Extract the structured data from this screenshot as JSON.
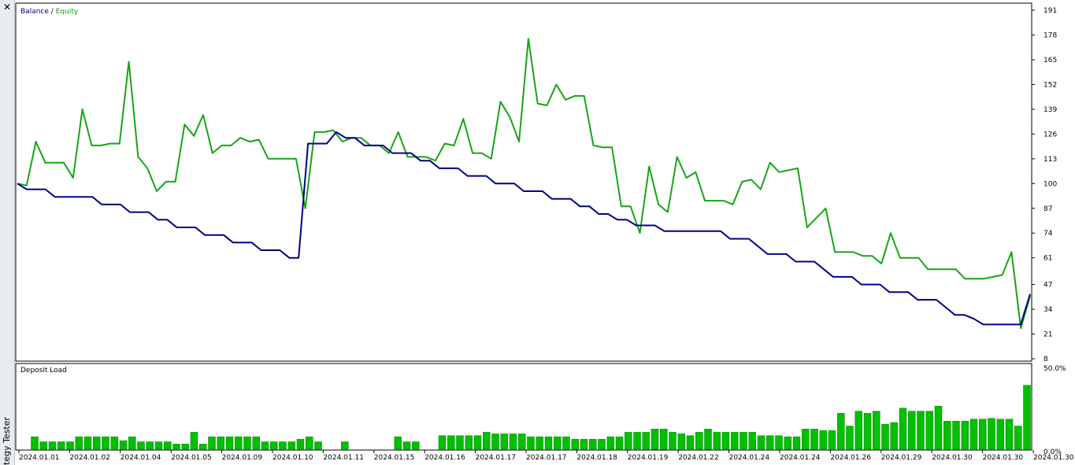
{
  "window": {
    "close_glyph": "✕",
    "side_label": "tegy Tester"
  },
  "colors": {
    "balance": "#00008b",
    "equity": "#16a516",
    "bars": "#00c000",
    "bar_border": "#008000",
    "frame": "#000000",
    "text": "#000000"
  },
  "chart_data": [
    {
      "type": "line",
      "title": "",
      "legend": [
        {
          "name": "Balance",
          "color": "#00008b"
        },
        {
          "name": "Equity",
          "color": "#16a516"
        }
      ],
      "legend_separator": " / ",
      "ylim": [
        8,
        191
      ],
      "yticks": [
        191,
        178,
        165,
        152,
        139,
        126,
        113,
        100,
        87,
        74,
        61,
        47,
        34,
        21,
        8
      ],
      "x_count": 103,
      "series": [
        {
          "name": "Balance",
          "values": [
            100,
            97,
            97,
            97,
            93,
            93,
            93,
            93,
            93,
            89,
            89,
            89,
            85,
            85,
            85,
            81,
            81,
            77,
            77,
            77,
            73,
            73,
            73,
            69,
            69,
            69,
            65,
            65,
            65,
            61,
            61,
            121,
            121,
            121,
            127,
            124,
            124,
            120,
            120,
            120,
            116,
            116,
            116,
            112,
            112,
            108,
            108,
            108,
            104,
            104,
            104,
            100,
            100,
            100,
            96,
            96,
            96,
            92,
            92,
            92,
            88,
            88,
            84,
            84,
            81,
            81,
            78,
            78,
            78,
            75,
            75,
            75,
            75,
            75,
            75,
            75,
            71,
            71,
            71,
            67,
            63,
            63,
            63,
            59,
            59,
            59,
            55,
            51,
            51,
            51,
            47,
            47,
            47,
            43,
            43,
            43,
            39,
            39,
            39,
            35,
            31,
            31,
            29,
            26,
            26,
            26,
            26,
            26,
            42
          ]
        },
        {
          "name": "Equity",
          "values": [
            100,
            99,
            122,
            111,
            111,
            111,
            103,
            139,
            120,
            120,
            121,
            121,
            164,
            114,
            108,
            96,
            101,
            101,
            131,
            125,
            136,
            116,
            120,
            120,
            124,
            122,
            123,
            113,
            113,
            113,
            113,
            87,
            127,
            127,
            128,
            122,
            124,
            124,
            120,
            120,
            116,
            127,
            114,
            114,
            114,
            112,
            121,
            120,
            134,
            116,
            116,
            113,
            143,
            135,
            122,
            176,
            142,
            141,
            152,
            144,
            146,
            146,
            120,
            119,
            119,
            88,
            88,
            74,
            109,
            89,
            85,
            114,
            103,
            106,
            91,
            91,
            91,
            89,
            101,
            102,
            97,
            111,
            106,
            107,
            108,
            77,
            82,
            87,
            64,
            64,
            64,
            62,
            62,
            58,
            74,
            61,
            61,
            61,
            55,
            55,
            55,
            55,
            50,
            50,
            50,
            51,
            52,
            64,
            24,
            41
          ]
        }
      ]
    },
    {
      "type": "bar",
      "title": "Deposit Load",
      "ylim": [
        0,
        50
      ],
      "ytick_labels": [
        "50.0%",
        "0.0%"
      ],
      "values": [
        7.7,
        4.6,
        4.6,
        4.6,
        4.6,
        7.7,
        7.7,
        7.7,
        7.7,
        7.7,
        5.3,
        7.7,
        4.6,
        4.6,
        4.6,
        4.6,
        3.2,
        3.2,
        10.5,
        3.2,
        7.7,
        7.7,
        7.7,
        7.7,
        7.7,
        7.7,
        4.6,
        4.6,
        4.6,
        4.6,
        6.2,
        7.7,
        4.6,
        0,
        0,
        4.6,
        0,
        0,
        0,
        0,
        0,
        7.7,
        4.6,
        4.6,
        0,
        0,
        8.4,
        8.4,
        8.4,
        8.4,
        8.4,
        10.5,
        9.5,
        9.5,
        9.5,
        9.5,
        7.7,
        7.7,
        7.7,
        7.7,
        7.7,
        6.2,
        6.2,
        6.2,
        6.2,
        7.7,
        7.7,
        10.5,
        10.5,
        10.5,
        12.5,
        12.5,
        10.5,
        9.5,
        8.4,
        10.5,
        12.5,
        10.5,
        10.5,
        10.5,
        10.5,
        10.5,
        8.4,
        8.4,
        8.4,
        7.7,
        7.7,
        12.5,
        12.5,
        11.6,
        11.6,
        22.2,
        14.3,
        23.5,
        22.2,
        23.5,
        15.5,
        16.5,
        25.4,
        23.5,
        23.5,
        23.5,
        26.6,
        17.4,
        17.4,
        17.4,
        18.6,
        18.6,
        19.1,
        18.6,
        18.6,
        14.3,
        39.5
      ],
      "xtick_labels": [
        "2024.01.01",
        "2024.01.02",
        "2024.01.04",
        "2024.01.05",
        "2024.01.09",
        "2024.01.10",
        "2024.01.11",
        "2024.01.15",
        "2024.01.16",
        "2024.01.17",
        "2024.01.17",
        "2024.01.18",
        "2024.01.19",
        "2024.01.22",
        "2024.01.24",
        "2024.01.24",
        "2024.01.26",
        "2024.01.29",
        "2024.01.30",
        "2024.01.30",
        "2024.01.30"
      ]
    }
  ]
}
